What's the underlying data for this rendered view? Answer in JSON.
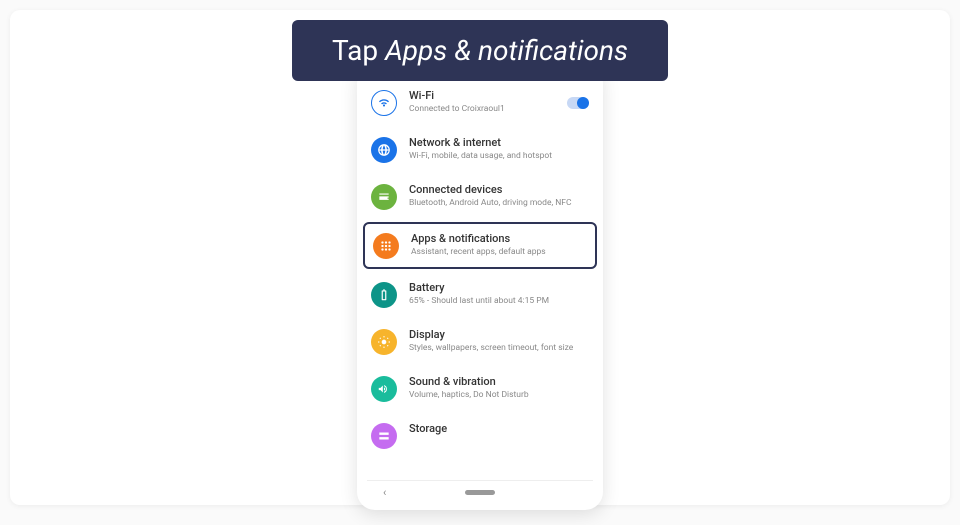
{
  "instruction": {
    "prefix": "Tap ",
    "emphasis": "Apps & notifications"
  },
  "settings": {
    "wifi": {
      "title": "Wi-Fi",
      "subtitle": "Connected to Croixraoul1"
    },
    "network": {
      "title": "Network & internet",
      "subtitle": "Wi-Fi, mobile, data usage, and hotspot"
    },
    "connected": {
      "title": "Connected devices",
      "subtitle": "Bluetooth, Android Auto, driving mode, NFC"
    },
    "apps": {
      "title": "Apps & notifications",
      "subtitle": "Assistant, recent apps, default apps"
    },
    "battery": {
      "title": "Battery",
      "subtitle": "65% - Should last until about 4:15 PM"
    },
    "display": {
      "title": "Display",
      "subtitle": "Styles, wallpapers, screen timeout, font size"
    },
    "sound": {
      "title": "Sound & vibration",
      "subtitle": "Volume, haptics, Do Not Disturb"
    },
    "storage": {
      "title": "Storage",
      "subtitle": ""
    }
  },
  "nav": {
    "back": "‹"
  }
}
